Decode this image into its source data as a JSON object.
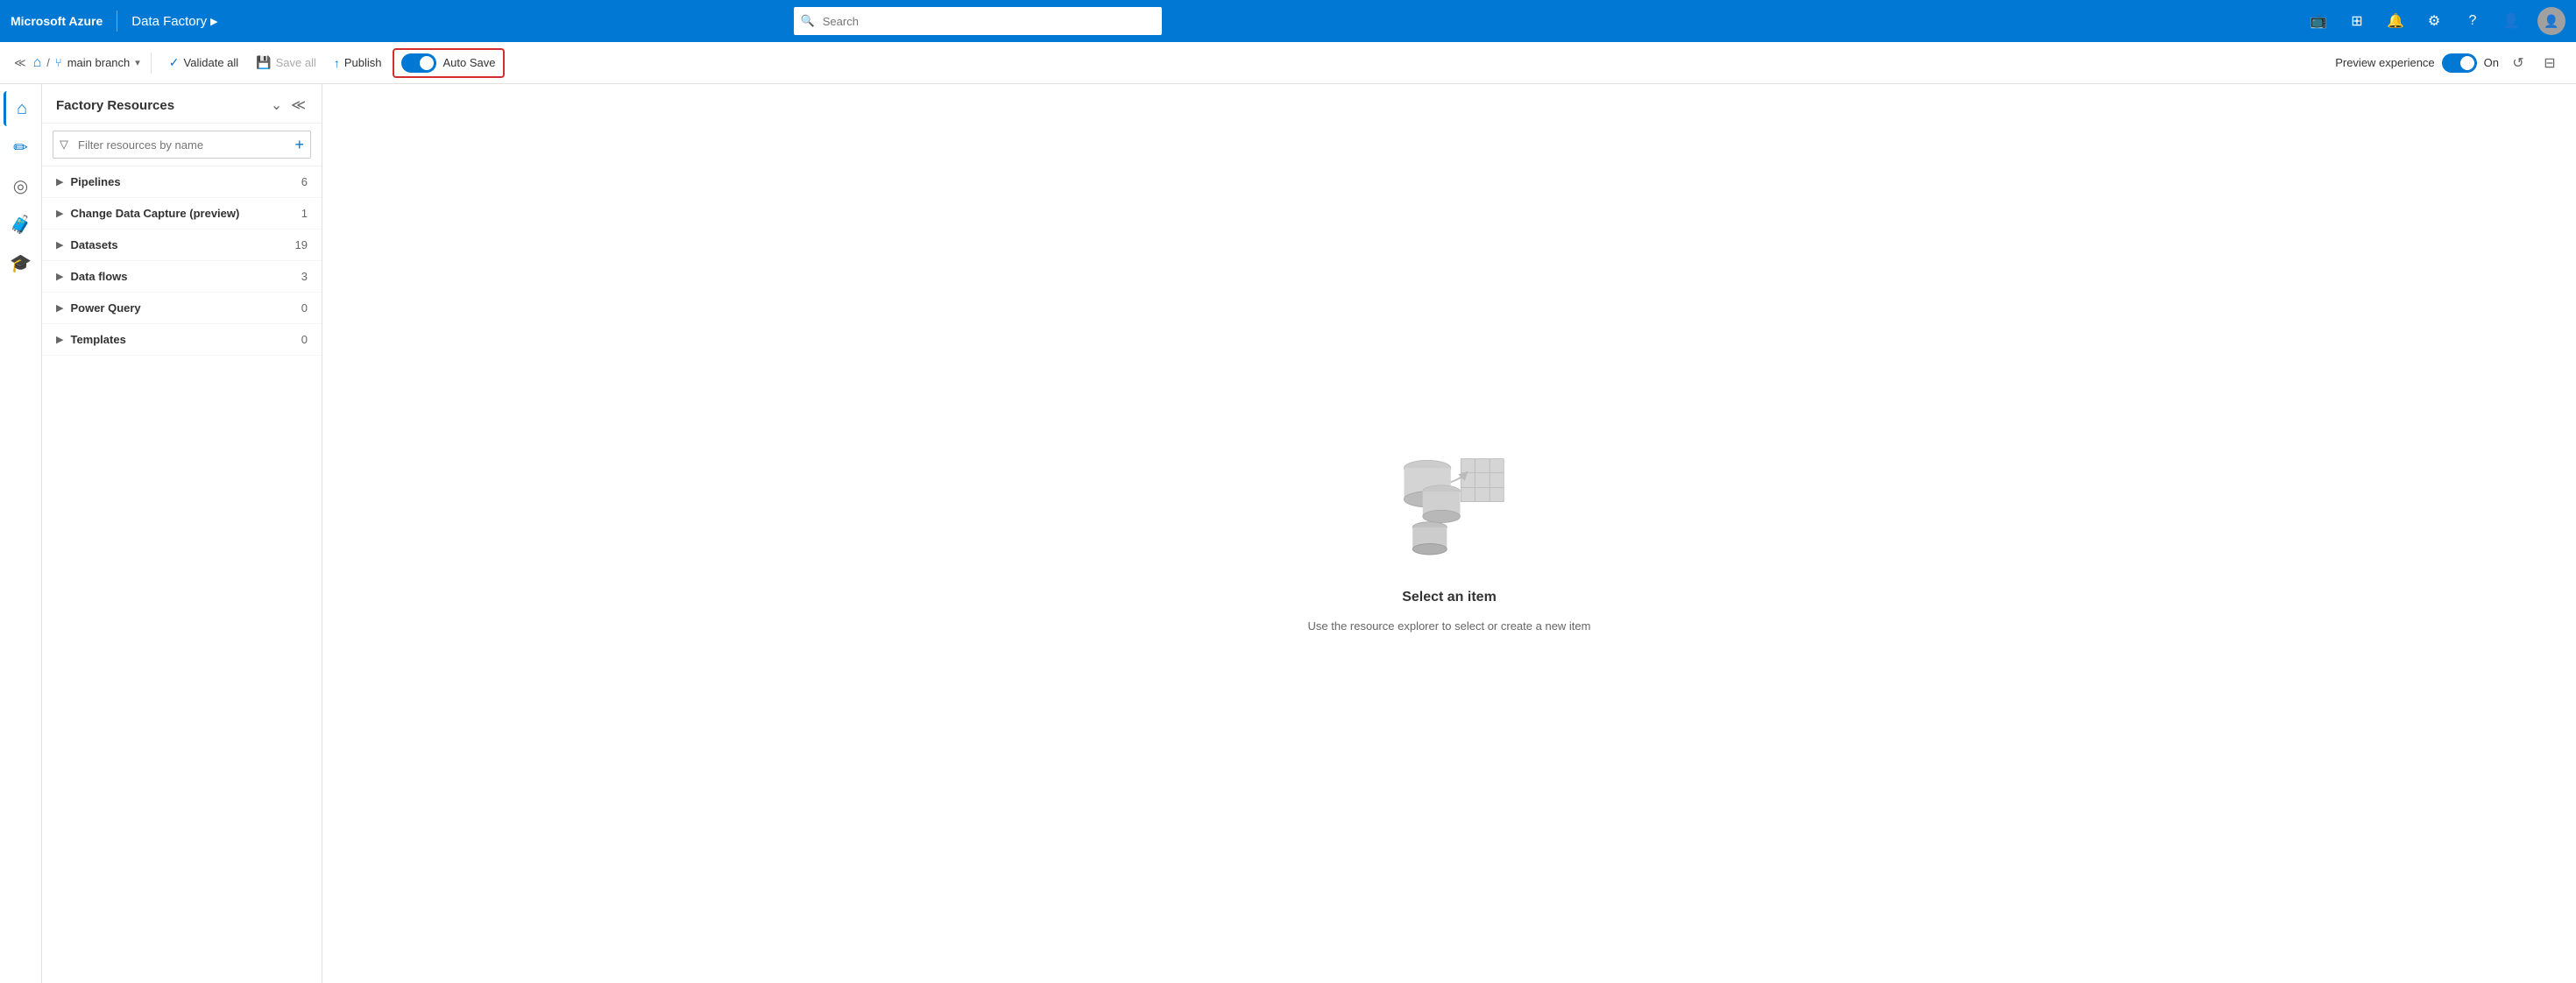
{
  "topnav": {
    "brand": "Microsoft Azure",
    "divider": "|",
    "app_name": "Data Factory",
    "app_chevron": "▶",
    "search_placeholder": "Search",
    "icons": [
      "📺",
      "⊞",
      "🔔",
      "⚙",
      "?",
      "👤"
    ]
  },
  "toolbar": {
    "collapse_icon": "≪",
    "slash": "/",
    "branch_icon": "⑂",
    "branch_name": "main branch",
    "branch_chevron": "▾",
    "validate_icon": "✓",
    "validate_label": "Validate all",
    "save_icon": "💾",
    "save_label": "Save all",
    "publish_icon": "↑",
    "publish_label": "Publish",
    "autosave_label": "Auto Save",
    "autosave_on": true,
    "preview_label": "Preview experience",
    "preview_on": "On",
    "refresh_icon": "↺"
  },
  "resources_panel": {
    "title": "Factory Resources",
    "filter_placeholder": "Filter resources by name",
    "items": [
      {
        "name": "Pipelines",
        "count": "6"
      },
      {
        "name": "Change Data Capture (preview)",
        "count": "1"
      },
      {
        "name": "Datasets",
        "count": "19"
      },
      {
        "name": "Data flows",
        "count": "3"
      },
      {
        "name": "Power Query",
        "count": "0"
      },
      {
        "name": "Templates",
        "count": "0"
      }
    ]
  },
  "main_content": {
    "empty_title": "Select an item",
    "empty_subtitle": "Use the resource explorer to select or create a new item"
  }
}
